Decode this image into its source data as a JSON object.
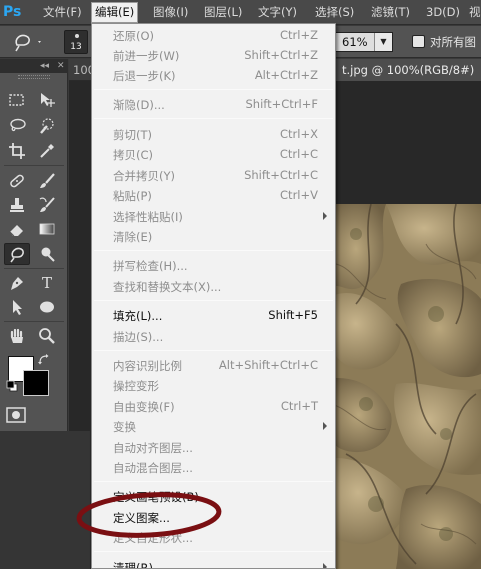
{
  "app": {
    "logo": "Ps",
    "menu": [
      {
        "label": "文件(F)",
        "active": false
      },
      {
        "label": "编辑(E)",
        "active": true
      },
      {
        "label": "图像(I)",
        "active": false
      },
      {
        "label": "图层(L)",
        "active": false
      },
      {
        "label": "文字(Y)",
        "active": false
      },
      {
        "label": "选择(S)",
        "active": false
      },
      {
        "label": "滤镜(T)",
        "active": false
      },
      {
        "label": "3D(D)",
        "active": false
      },
      {
        "label": "视",
        "active": false
      }
    ]
  },
  "options_bar": {
    "brush_size": "13",
    "zoom": "61%",
    "sample_all_layers_label": "对所有图",
    "sample_all_layers_checked": false
  },
  "tools": {
    "selected": "spot-healing",
    "foreground_color": "#ffffff",
    "background_color": "#000000"
  },
  "document": {
    "left_tab_fragment": "100",
    "active_tab_title": "t.jpg @ 100%(RGB/8#)"
  },
  "edit_menu": {
    "items": [
      {
        "label": "还原(O)",
        "shortcut": "Ctrl+Z",
        "enabled": false
      },
      {
        "label": "前进一步(W)",
        "shortcut": "Shift+Ctrl+Z",
        "enabled": false
      },
      {
        "label": "后退一步(K)",
        "shortcut": "Alt+Ctrl+Z",
        "enabled": false
      },
      {
        "label": "渐隐(D)...",
        "shortcut": "Shift+Ctrl+F",
        "enabled": false
      },
      {
        "label": "剪切(T)",
        "shortcut": "Ctrl+X",
        "enabled": false
      },
      {
        "label": "拷贝(C)",
        "shortcut": "Ctrl+C",
        "enabled": false
      },
      {
        "label": "合并拷贝(Y)",
        "shortcut": "Shift+Ctrl+C",
        "enabled": false
      },
      {
        "label": "粘贴(P)",
        "shortcut": "Ctrl+V",
        "enabled": false
      },
      {
        "label": "选择性粘贴(I)",
        "shortcut": "",
        "enabled": false,
        "submenu": true
      },
      {
        "label": "清除(E)",
        "shortcut": "",
        "enabled": false
      },
      {
        "label": "拼写检查(H)...",
        "shortcut": "",
        "enabled": false
      },
      {
        "label": "查找和替换文本(X)...",
        "shortcut": "",
        "enabled": false
      },
      {
        "label": "填充(L)...",
        "shortcut": "Shift+F5",
        "enabled": true
      },
      {
        "label": "描边(S)...",
        "shortcut": "",
        "enabled": false
      },
      {
        "label": "内容识别比例",
        "shortcut": "Alt+Shift+Ctrl+C",
        "enabled": false
      },
      {
        "label": "操控变形",
        "shortcut": "",
        "enabled": false
      },
      {
        "label": "自由变换(F)",
        "shortcut": "Ctrl+T",
        "enabled": false
      },
      {
        "label": "变换",
        "shortcut": "",
        "enabled": false,
        "submenu": true
      },
      {
        "label": "自动对齐图层...",
        "shortcut": "",
        "enabled": false
      },
      {
        "label": "自动混合图层...",
        "shortcut": "",
        "enabled": false
      },
      {
        "label": "定义画笔预设(B)...",
        "shortcut": "",
        "enabled": true
      },
      {
        "label": "定义图案...",
        "shortcut": "",
        "enabled": true
      },
      {
        "label": "定义自定形状...",
        "shortcut": "",
        "enabled": false
      },
      {
        "label": "清理(R)",
        "shortcut": "",
        "enabled": true,
        "submenu": true
      }
    ]
  },
  "annotation": {
    "color": "#7a0f12"
  }
}
